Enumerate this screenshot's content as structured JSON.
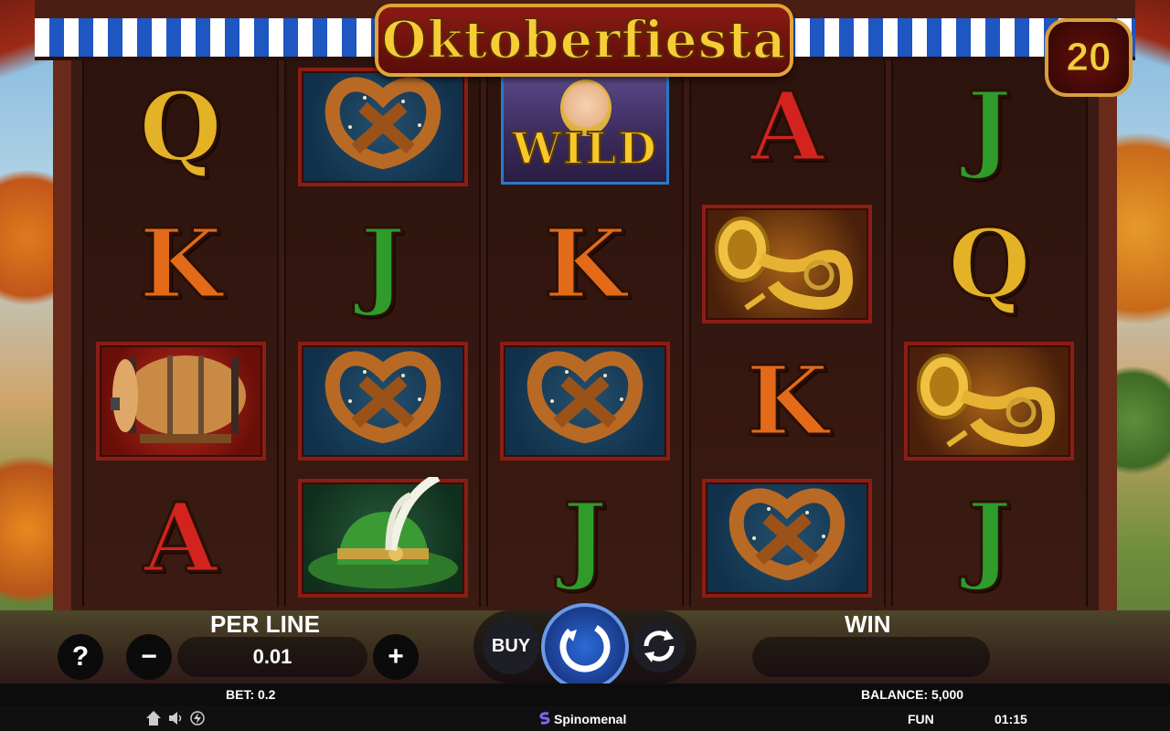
{
  "game": {
    "title": "Oktoberfiesta",
    "lines": "20"
  },
  "reels": [
    [
      {
        "type": "letter",
        "value": "Q"
      },
      {
        "type": "letter",
        "value": "K"
      },
      {
        "type": "symbol",
        "value": "beer-barrel",
        "tile": "red"
      },
      {
        "type": "letter",
        "value": "A"
      }
    ],
    [
      {
        "type": "symbol",
        "value": "pretzel",
        "tile": "blue"
      },
      {
        "type": "letter",
        "value": "J"
      },
      {
        "type": "symbol",
        "value": "pretzel",
        "tile": "blue"
      },
      {
        "type": "symbol",
        "value": "green-hat",
        "tile": "green"
      }
    ],
    [
      {
        "type": "wild",
        "value": "WILD"
      },
      {
        "type": "letter",
        "value": "K"
      },
      {
        "type": "symbol",
        "value": "pretzel",
        "tile": "blue"
      },
      {
        "type": "letter",
        "value": "J"
      }
    ],
    [
      {
        "type": "letter",
        "value": "A"
      },
      {
        "type": "symbol",
        "value": "tuba",
        "tile": "gold"
      },
      {
        "type": "letter",
        "value": "K"
      },
      {
        "type": "symbol",
        "value": "pretzel",
        "tile": "blue"
      }
    ],
    [
      {
        "type": "letter",
        "value": "J"
      },
      {
        "type": "letter",
        "value": "Q"
      },
      {
        "type": "symbol",
        "value": "tuba",
        "tile": "gold"
      },
      {
        "type": "letter",
        "value": "J"
      }
    ]
  ],
  "controls": {
    "help_label": "?",
    "per_line_label": "PER LINE",
    "per_line_value": "0.01",
    "minus_label": "−",
    "plus_label": "+",
    "buy_label": "BUY",
    "win_label": "WIN",
    "win_value": ""
  },
  "info": {
    "bet": "BET: 0.2",
    "balance": "BALANCE: 5,000"
  },
  "footer": {
    "brand": "Spinomenal",
    "mode": "FUN",
    "clock": "01:15"
  },
  "colors": {
    "accent_gold": "#f8cc36",
    "title_red": "#8a1a14",
    "spin_blue": "#2a6ad8"
  }
}
